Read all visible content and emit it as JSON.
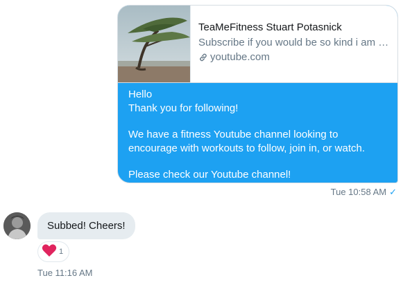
{
  "sent_message": {
    "link_card": {
      "title": "TeaMeFitness Stuart Potasnick",
      "description": "Subscribe if you would be so kind i am …",
      "domain": "youtube.com"
    },
    "text_lines": [
      "Hello",
      "Thank you for following!",
      "We have a fitness Youtube channel looking to",
      "encourage with workouts to follow, join in, or watch.",
      "Please check our Youtube channel!"
    ],
    "timestamp": "Tue 10:58 AM",
    "status": "✓"
  },
  "received_message": {
    "text": "Subbed! Cheers!",
    "reaction": {
      "icon": "heart-icon",
      "count": "1"
    },
    "timestamp": "Tue 11:16 AM"
  },
  "colors": {
    "accent": "#1da1f2",
    "received_bubble": "#e6ecf0",
    "muted_text": "#657786",
    "heart": "#e0245e"
  }
}
